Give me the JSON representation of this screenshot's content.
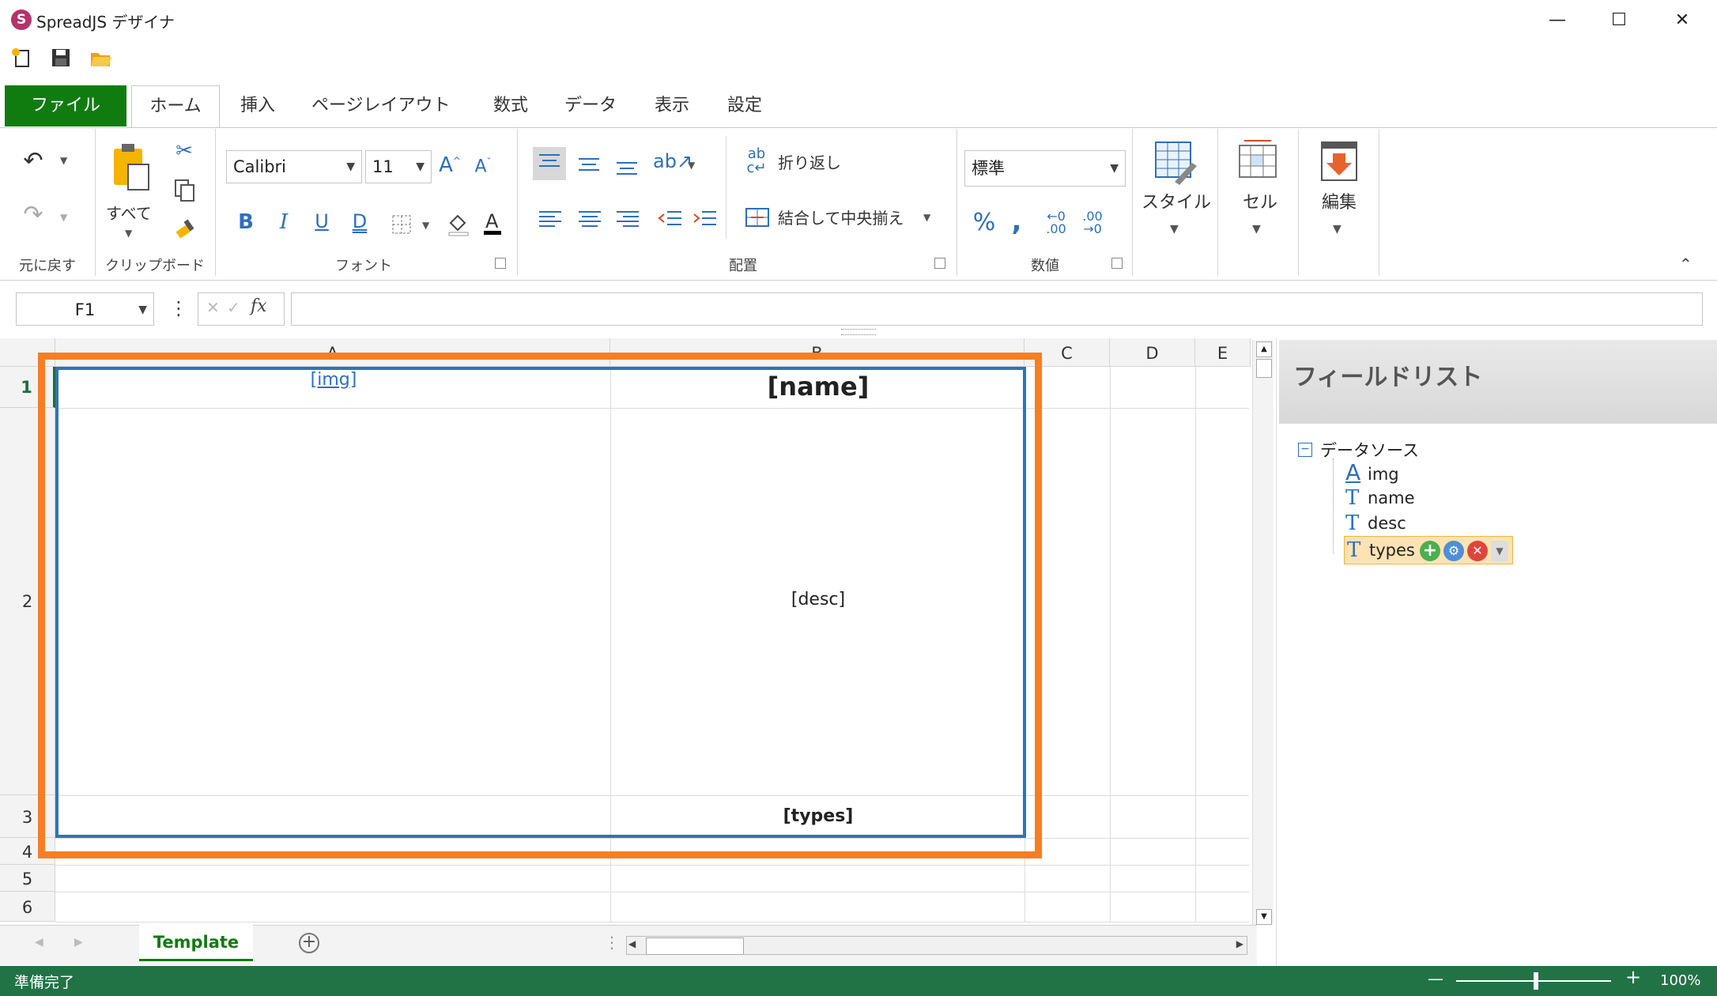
{
  "app": {
    "title": "SpreadJS デザイナ",
    "logo_letter": "S"
  },
  "window": {
    "minimize": "—",
    "maximize": "☐",
    "close": "✕"
  },
  "ribbon_tabs": [
    {
      "label": "ファイル"
    },
    {
      "label": "ホーム"
    },
    {
      "label": "挿入"
    },
    {
      "label": "ページレイアウト"
    },
    {
      "label": "数式"
    },
    {
      "label": "データ"
    },
    {
      "label": "表示"
    },
    {
      "label": "設定"
    }
  ],
  "ribbon": {
    "undo_group": "元に戻す",
    "clipboard_group": "クリップボード",
    "paste_label": "すべて",
    "font_group": "フォント",
    "font_name": "Calibri",
    "font_size": "11",
    "align_group": "配置",
    "wrap_text": "折り返し",
    "merge_center": "結合して中央揃え",
    "number_group": "数値",
    "number_format": "標準",
    "style_label": "スタイル",
    "cell_label": "セル",
    "edit_label": "編集"
  },
  "formula_bar": {
    "name_box": "F1",
    "fx": "fx",
    "cancel": "✕",
    "enter": "✓",
    "formula": ""
  },
  "sheet": {
    "columns": [
      "A",
      "B",
      "C",
      "D",
      "E"
    ],
    "rows": [
      "1",
      "2",
      "3",
      "4",
      "5",
      "6"
    ],
    "cells": {
      "A1": "[img]",
      "B1": "[name]",
      "B2": "[desc]",
      "B3": "[types]"
    }
  },
  "field_list": {
    "title": "フィールドリスト",
    "root": "データソース",
    "items": [
      {
        "name": "img",
        "icon": "hyperlink-field-icon",
        "glyph": "A"
      },
      {
        "name": "name",
        "icon": "text-field-icon",
        "glyph": "T"
      },
      {
        "name": "desc",
        "icon": "text-field-icon",
        "glyph": "T"
      },
      {
        "name": "types",
        "icon": "text-field-icon",
        "glyph": "T"
      }
    ]
  },
  "sheet_tabs": {
    "active": "Template",
    "add": "+"
  },
  "status": {
    "ready": "準備完了",
    "zoom": "100%",
    "minus": "—",
    "plus": "+"
  },
  "colors": {
    "brand_green": "#107c10",
    "status_green": "#217346",
    "highlight_orange": "#f47f24",
    "selection_blue": "#2e75b6"
  }
}
